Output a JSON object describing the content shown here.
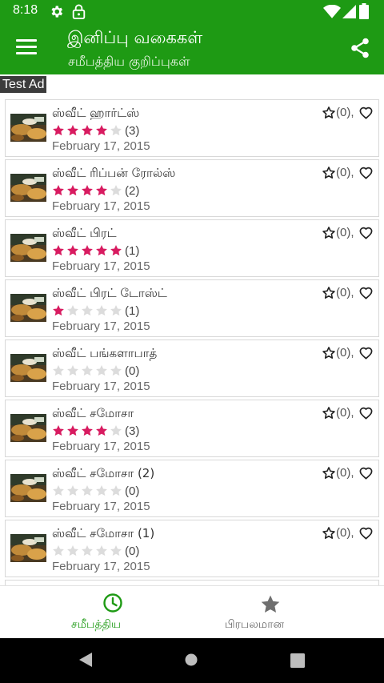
{
  "status_bar": {
    "time": "8:18"
  },
  "app_bar": {
    "title": "இனிப்பு வகைகள்",
    "subtitle": "சமீபத்திய குறிப்புகள்"
  },
  "ad": {
    "label": "Test Ad"
  },
  "colors": {
    "primary": "#1e9a14",
    "star_filled": "#d81b60",
    "star_empty": "#dcdcdc"
  },
  "recipes": [
    {
      "name": "ஸ்வீட் ஹார்ட்ஸ்",
      "rating": 4,
      "rating_count": "(3)",
      "date": "February 17, 2015",
      "fav_count": "(0),"
    },
    {
      "name": "ஸ்வீட் ரிப்பன் ரோல்ஸ்",
      "rating": 4,
      "rating_count": "(2)",
      "date": "February 17, 2015",
      "fav_count": "(0),"
    },
    {
      "name": "ஸ்வீட் பிரட்",
      "rating": 5,
      "rating_count": "(1)",
      "date": "February 17, 2015",
      "fav_count": "(0),"
    },
    {
      "name": "ஸ்வீட் பிரட் டோஸ்ட்",
      "rating": 1,
      "rating_count": "(1)",
      "date": "February 17, 2015",
      "fav_count": "(0),"
    },
    {
      "name": "ஸ்வீட் பங்களாபாத்",
      "rating": 0,
      "rating_count": "(0)",
      "date": "February 17, 2015",
      "fav_count": "(0),"
    },
    {
      "name": "ஸ்வீட் சமோசா",
      "rating": 4,
      "rating_count": "(3)",
      "date": "February 17, 2015",
      "fav_count": "(0),"
    },
    {
      "name": "ஸ்வீட் சமோசா (2)",
      "rating": 0,
      "rating_count": "(0)",
      "date": "February 17, 2015",
      "fav_count": "(0),"
    },
    {
      "name": "ஸ்வீட் சமோசா (1)",
      "rating": 0,
      "rating_count": "(0)",
      "date": "February 17, 2015",
      "fav_count": "(0),"
    },
    {
      "name": "",
      "rating": 0,
      "rating_count": "",
      "date": "",
      "fav_count": ""
    }
  ],
  "bottom_nav": {
    "tabs": [
      {
        "label": "சமீபத்திய",
        "icon": "clock-icon",
        "active": true
      },
      {
        "label": "பிரபலமான",
        "icon": "star-icon",
        "active": false
      }
    ]
  }
}
